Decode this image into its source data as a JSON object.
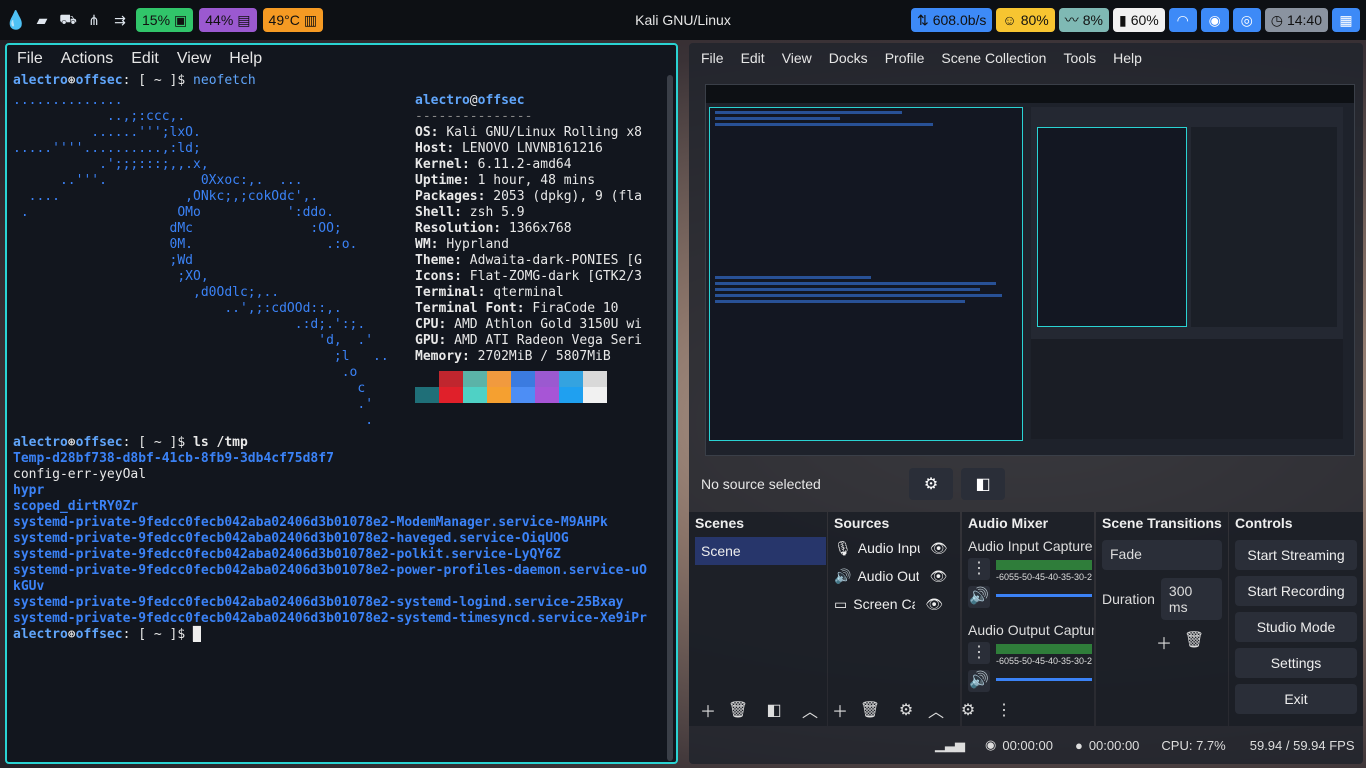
{
  "topbar": {
    "title": "Kali GNU/Linux",
    "cpu": "15%",
    "mem": "44%",
    "temp": "49°C",
    "net": "608.0b/s",
    "brightness": "80%",
    "volume": "8%",
    "battery": "60%",
    "time": "14:40",
    "colors": {
      "green": "#31c56a",
      "purple": "#9b59d0",
      "orange": "#f59a23",
      "blue": "#3d8af7",
      "yellow": "#f7c531",
      "teal": "#7fb9b4",
      "white": "#f1f1f1",
      "slate": "#8a93a0"
    }
  },
  "terminal": {
    "menu": [
      "File",
      "Actions",
      "Edit",
      "View",
      "Help"
    ],
    "user": "alectro",
    "host": "offsec",
    "cmd1": "neofetch",
    "info_title_user": "alectro",
    "info_title_host": "offsec",
    "info": [
      {
        "k": "OS",
        "v": "Kali GNU/Linux Rolling x8"
      },
      {
        "k": "Host",
        "v": "LENOVO LNVNB161216"
      },
      {
        "k": "Kernel",
        "v": "6.11.2-amd64"
      },
      {
        "k": "Uptime",
        "v": "1 hour, 48 mins"
      },
      {
        "k": "Packages",
        "v": "2053 (dpkg), 9 (fla"
      },
      {
        "k": "Shell",
        "v": "zsh 5.9"
      },
      {
        "k": "Resolution",
        "v": "1366x768"
      },
      {
        "k": "WM",
        "v": "Hyprland"
      },
      {
        "k": "Theme",
        "v": "Adwaita-dark-PONIES [G"
      },
      {
        "k": "Icons",
        "v": "Flat-ZOMG-dark [GTK2/3"
      },
      {
        "k": "Terminal",
        "v": "qterminal"
      },
      {
        "k": "Terminal Font",
        "v": "FiraCode 10"
      },
      {
        "k": "CPU",
        "v": "AMD Athlon Gold 3150U wi"
      },
      {
        "k": "GPU",
        "v": "AMD ATI Radeon Vega Seri"
      },
      {
        "k": "Memory",
        "v": "2702MiB / 5807MiB"
      }
    ],
    "logo": [
      "..............",
      "            ..,;:ccc,.",
      "          ......''';lxO.",
      ".....''''..........,:ld;",
      "           .';;;:::;,,.x,",
      "      ..'''.            0Xxoc:,.  ...",
      "  ....                ,ONkc;,;cokOdc',.",
      " .                   OMo           ':ddo.",
      "                    dMc               :OO;",
      "                    0M.                 .:o.",
      "                    ;Wd",
      "                     ;XO,",
      "                       ,d0Odlc;,..",
      "                           ..',;:cdOOd::,.",
      "                                    .:d;.':;.",
      "                                       'd,  .'",
      "                                         ;l   ..",
      "                                          .o",
      "                                            c",
      "                                            .'",
      "                                             ."
    ],
    "cmd2": "ls /tmp",
    "ls": [
      {
        "t": "Temp-d28bf738-d8bf-41cb-8fb9-3db4cf75d8f7",
        "dir": true
      },
      {
        "t": "config-err-yeyOal",
        "dir": false
      },
      {
        "t": "hypr",
        "dir": true
      },
      {
        "t": "scoped_dirtRY0Zr",
        "dir": true
      },
      {
        "t": "systemd-private-9fedcc0fecb042aba02406d3b01078e2-ModemManager.service-M9AHPk",
        "dir": true
      },
      {
        "t": "systemd-private-9fedcc0fecb042aba02406d3b01078e2-haveged.service-OiqUOG",
        "dir": true
      },
      {
        "t": "systemd-private-9fedcc0fecb042aba02406d3b01078e2-polkit.service-LyQY6Z",
        "dir": true
      },
      {
        "t": "systemd-private-9fedcc0fecb042aba02406d3b01078e2-power-profiles-daemon.service-uO",
        "dir": true
      },
      {
        "t": "kGUv",
        "dir": true
      },
      {
        "t": "systemd-private-9fedcc0fecb042aba02406d3b01078e2-systemd-logind.service-25Bxay",
        "dir": true
      },
      {
        "t": "systemd-private-9fedcc0fecb042aba02406d3b01078e2-systemd-timesyncd.service-Xe9iPr",
        "dir": true
      }
    ],
    "palette_top": [
      "#12161e",
      "#c0262e",
      "#5bb3a8",
      "#f19a3e",
      "#3b7be0",
      "#9b59d0",
      "#34a3e0",
      "#d9d9d9"
    ],
    "palette_bottom": [
      "#1f6f78",
      "#e0202a",
      "#4fd1c5",
      "#f5a030",
      "#4d8ef5",
      "#a755d6",
      "#1fa0f0",
      "#f1f1f1"
    ]
  },
  "obs": {
    "menu": [
      "File",
      "Edit",
      "View",
      "Docks",
      "Profile",
      "Scene Collection",
      "Tools",
      "Help"
    ],
    "no_source": "No source selected",
    "scenes_title": "Scenes",
    "scene": "Scene",
    "sources_title": "Sources",
    "sources": [
      "Audio Inpu",
      "Audio Outp",
      "Screen Cap"
    ],
    "mixer_title": "Audio Mixer",
    "mixer_input": "Audio Input Capture",
    "mixer_output": "Audio Output Captur",
    "meter_ticks": "-6055-50-45-40-35-30-2",
    "trans_title": "Scene Transitions",
    "transition": "Fade",
    "duration_label": "Duration",
    "duration": "300 ms",
    "controls_title": "Controls",
    "controls": [
      "Start Streaming",
      "Start Recording",
      "Studio Mode",
      "Settings",
      "Exit"
    ],
    "status": {
      "stream": "00:00:00",
      "rec": "00:00:00",
      "cpu": "CPU: 7.7%",
      "fps": "59.94 / 59.94 FPS"
    }
  }
}
